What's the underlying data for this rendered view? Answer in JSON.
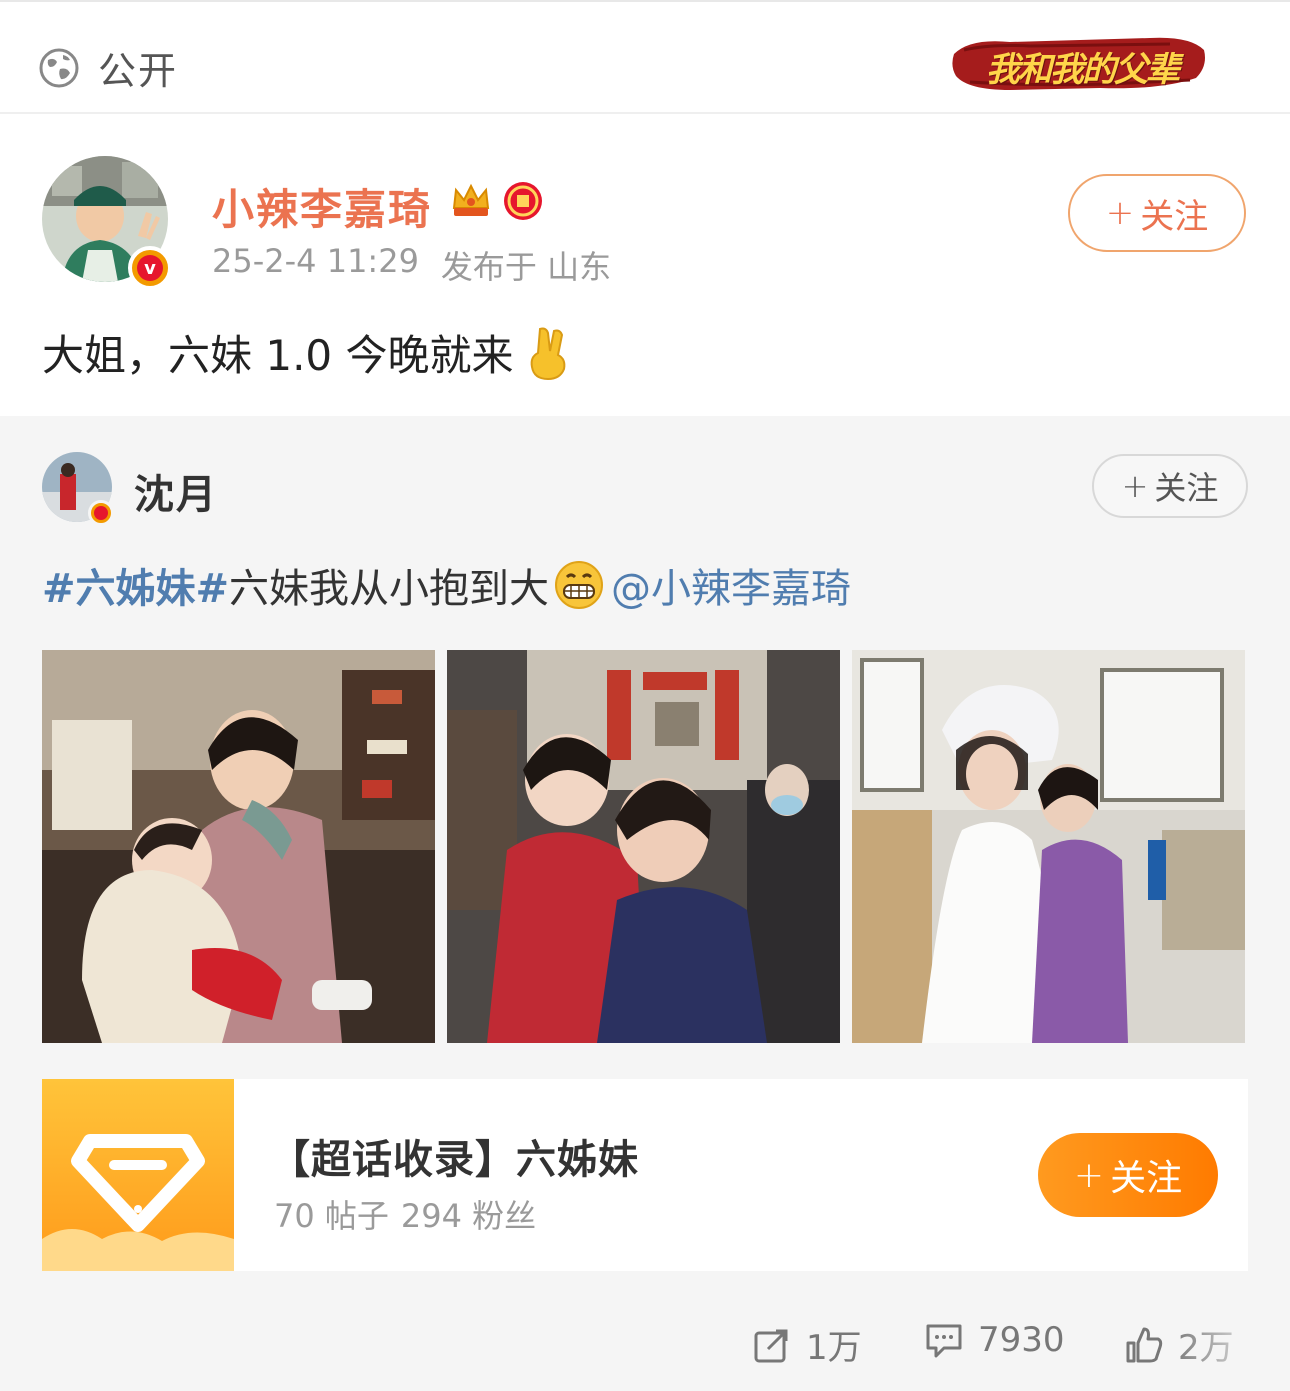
{
  "visibility": {
    "label": "公开",
    "icon": "globe-icon"
  },
  "banner": {
    "text": "我和我的父辈"
  },
  "author": {
    "name": "小辣李嘉琦",
    "time": "25-2-4 11:29",
    "location": "发布于 山东",
    "follow_label": "关注",
    "follow_plus": "+"
  },
  "post": {
    "text": "大姐，六妹 1.0 今晚就来"
  },
  "retweet": {
    "author": "沈月",
    "follow_label": "关注",
    "follow_plus": "+",
    "hashtag": "#六姊妹#",
    "text": " 六妹我从小抱到大",
    "mention": "@小辣李嘉琦"
  },
  "topic": {
    "title": "【超话收录】六姊妹",
    "posts": "70 帖子",
    "fans": "294 粉丝",
    "follow_label": "关注",
    "follow_plus": "+"
  },
  "actions": {
    "repost": "1万",
    "comment": "7930",
    "like": "2万"
  },
  "colors": {
    "username": "#eb7350",
    "link": "#507daf",
    "follow_orange": "#ff8a00",
    "retweet_bg": "#f5f5f5"
  }
}
